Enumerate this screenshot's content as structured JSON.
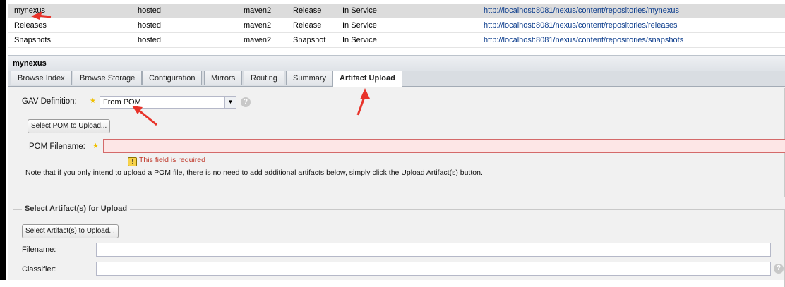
{
  "repositories": [
    {
      "name": "mynexus",
      "type": "hosted",
      "format": "maven2",
      "policy": "Release",
      "status": "In Service",
      "url": "http://localhost:8081/nexus/content/repositories/mynexus"
    },
    {
      "name": "Releases",
      "type": "hosted",
      "format": "maven2",
      "policy": "Release",
      "status": "In Service",
      "url": "http://localhost:8081/nexus/content/repositories/releases"
    },
    {
      "name": "Snapshots",
      "type": "hosted",
      "format": "maven2",
      "policy": "Snapshot",
      "status": "In Service",
      "url": "http://localhost:8081/nexus/content/repositories/snapshots"
    }
  ],
  "panel": {
    "title": "mynexus"
  },
  "tabs": [
    "Browse Index",
    "Browse Storage",
    "Configuration",
    "Mirrors",
    "Routing",
    "Summary",
    "Artifact Upload"
  ],
  "active_tab": "Artifact Upload",
  "form": {
    "gav_label": "GAV Definition:",
    "gav_value": "From POM",
    "select_pom_button": "Select POM to Upload...",
    "pom_filename_label": "POM Filename:",
    "error_text": "This field is required",
    "note": "Note that if you only intend to upload a POM file, there is no need to add additional artifacts below, simply click the Upload Artifact(s) button."
  },
  "artifacts": {
    "legend": "Select Artifact(s) for Upload",
    "select_button": "Select Artifact(s) to Upload...",
    "filename_label": "Filename:",
    "classifier_label": "Classifier:"
  },
  "icons": {
    "help": "help-icon",
    "required": "star-icon",
    "warning": "warning-icon",
    "dropdown": "chevron-down-icon"
  },
  "colors": {
    "annotation_arrow": "#e8332a",
    "invalid_field": "#fde6e6",
    "error_text": "#c0392b"
  }
}
